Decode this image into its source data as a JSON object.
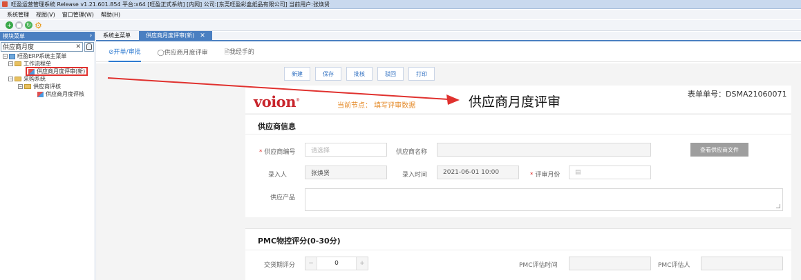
{
  "window": {
    "title": "旺盈运营管理系统 Release v1.21.601.854 平台:x64  [旺盈正式系统] [内网] 公司:[东莞旺盈彩盒纸品有限公司] 当前用户:张焕贤"
  },
  "menu": [
    "系统管理",
    "视图(V)",
    "窗口管理(W)",
    "帮助(H)"
  ],
  "left_panel": {
    "header": "模块菜单",
    "pin": "ᵖ",
    "search_value": "供应商月度",
    "clear": "✕",
    "tree": {
      "root": "旺盈ERP系统主菜单",
      "workflow": "工作流程单",
      "workflow_item": "供应商月度评审(新)",
      "purchase": "采购系统",
      "supplier_eval": "供应商评核",
      "supplier_eval_item": "供应商月度评核"
    }
  },
  "tabs": [
    {
      "label": "系统主菜单",
      "active": false
    },
    {
      "label": "供应商月度评审(新)",
      "active": true,
      "close": "✕"
    }
  ],
  "subtabs": [
    {
      "label": "⊘开单/审批",
      "active": true
    },
    {
      "label": "◯供应商月度评审",
      "active": false
    },
    {
      "label": "🗎我经手的",
      "active": false
    }
  ],
  "actions": [
    "新建",
    "保存",
    "批核",
    "驳回",
    "打印"
  ],
  "form_header": {
    "logo": "voion",
    "logo_mark": "®",
    "current_node": "当前节点： 填写评审数据",
    "title": "供应商月度评审",
    "number_label": "表单单号：",
    "number_value": "DSMA21060071"
  },
  "supplier_section": {
    "title": "供应商信息",
    "supplier_code_label": "供应商编号",
    "supplier_code_placeholder": "请选择",
    "supplier_name_label": "供应商名称",
    "supplier_name_value": "",
    "view_file_button": "查看供应商文件",
    "entry_person_label": "录入人",
    "entry_person_value": "张焕贤",
    "entry_time_label": "录入时间",
    "entry_time_value": "2021-06-01 10:00",
    "review_month_label": "评审月份",
    "review_month_icon": "▤",
    "product_label": "供应产品",
    "required_mark": "*"
  },
  "pmc_section": {
    "title": "PMC物控评分(0-30分)",
    "delivery_score_label": "交货期评分",
    "delivery_score_value": "0",
    "minus": "−",
    "plus": "+",
    "eval_time_label": "PMC评估时间",
    "evaluator_label": "PMC评估人"
  },
  "colors": {
    "accent_blue": "#4a7fc1",
    "link_blue": "#2f7bd1",
    "logo_red": "#c8242b",
    "annotation_red": "#e0312e",
    "node_orange": "#e58b2a"
  }
}
